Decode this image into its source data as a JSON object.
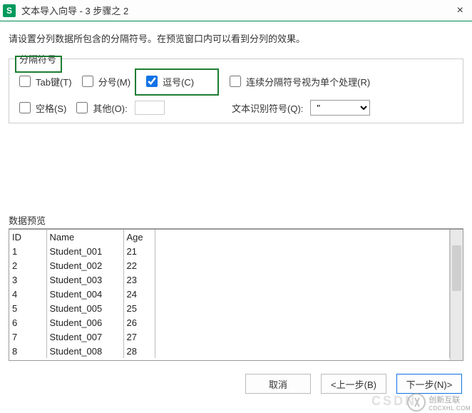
{
  "window": {
    "app_letter": "S",
    "title": "文本导入向导 - 3 步骤之 2",
    "close": "×"
  },
  "instruction": "请设置分列数据所包含的分隔符号。在预览窗口内可以看到分列的效果。",
  "delimiter": {
    "legend": "分隔符号",
    "tab": {
      "label": "Tab键(T)",
      "checked": false
    },
    "semicolon": {
      "label": "分号(M)",
      "checked": false
    },
    "comma": {
      "label": "逗号(C)",
      "checked": true
    },
    "consecutive": {
      "label": "连续分隔符号视为单个处理(R)",
      "checked": false
    },
    "space": {
      "label": "空格(S)",
      "checked": false
    },
    "other": {
      "label": "其他(O):",
      "checked": false,
      "value": ""
    },
    "text_qualifier_label": "文本识别符号(Q):",
    "text_qualifier_value": "\""
  },
  "preview": {
    "label": "数据预览",
    "columns": [
      "ID",
      "Name",
      "Age"
    ],
    "rows": [
      [
        "1",
        "Student_001",
        "21"
      ],
      [
        "2",
        "Student_002",
        "22"
      ],
      [
        "3",
        "Student_003",
        "23"
      ],
      [
        "4",
        "Student_004",
        "24"
      ],
      [
        "5",
        "Student_005",
        "25"
      ],
      [
        "6",
        "Student_006",
        "26"
      ],
      [
        "7",
        "Student_007",
        "27"
      ],
      [
        "8",
        "Student_008",
        "28"
      ]
    ]
  },
  "buttons": {
    "cancel": "取消",
    "back": "<上一步(B)",
    "next": "下一步(N)>"
  },
  "watermark": {
    "csdn": "CSDN",
    "brand": "创新互联",
    "brand_sub": "CDCXHL.COM"
  }
}
